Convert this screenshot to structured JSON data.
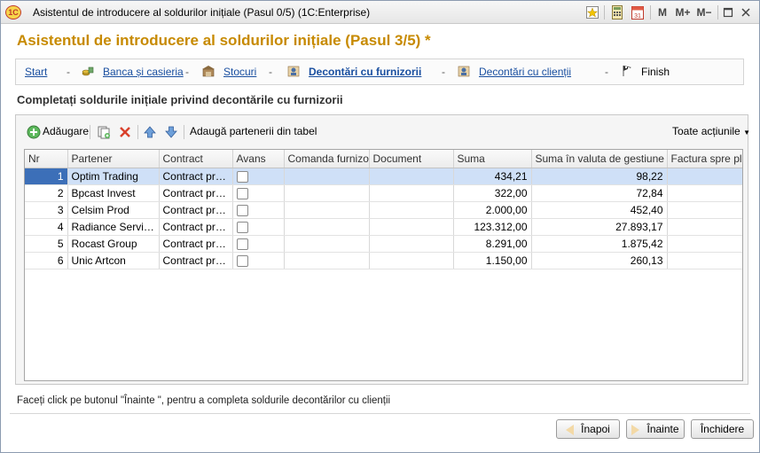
{
  "window": {
    "title": "Asistentul de introducere al soldurilor inițiale (Pasul 0/5)  (1C:Enterprise)",
    "app_icon": "1C",
    "buttons": [
      "M",
      "M+",
      "M−"
    ]
  },
  "header": {
    "title": "Asistentul de introducere al soldurilor inițiale (Pasul 3/5) *"
  },
  "steps": [
    {
      "label": "Start",
      "state": "link",
      "icon": ""
    },
    {
      "label": "Banca și casieria",
      "state": "link",
      "icon": "coins-icon"
    },
    {
      "label": "Stocuri",
      "state": "link",
      "icon": "warehouse-icon"
    },
    {
      "label": "Decontări cu furnizorii",
      "state": "active",
      "icon": "supplier-icon"
    },
    {
      "label": "Decontări cu clienții",
      "state": "link",
      "icon": "client-icon"
    },
    {
      "label": "Finish",
      "state": "plain",
      "icon": "finish-flag-icon"
    }
  ],
  "section": {
    "title": "Completați soldurile inițiale privind decontările cu furnizorii"
  },
  "toolbar": {
    "add_label": "Adăugare",
    "add_from_table_label": "Adaugă partenerii din tabel",
    "all_actions_label": "Toate acțiunile"
  },
  "table": {
    "columns": [
      "Nr",
      "Partener",
      "Contract",
      "Avans",
      "Comanda furnizor",
      "Document",
      "Suma",
      "Suma în valuta de gestiune",
      "Factura spre pl..."
    ],
    "rows": [
      {
        "nr": "1",
        "partener": "Optim Trading",
        "contract": "Contract prin...",
        "suma": "434,21",
        "suma_valuta": "98,22"
      },
      {
        "nr": "2",
        "partener": "Bpcast Invest",
        "contract": "Contract prin...",
        "suma": "322,00",
        "suma_valuta": "72,84"
      },
      {
        "nr": "3",
        "partener": "Celsim Prod",
        "contract": "Contract prin...",
        "suma": "2.000,00",
        "suma_valuta": "452,40"
      },
      {
        "nr": "4",
        "partener": "Radiance Service",
        "contract": "Contract prin...",
        "suma": "123.312,00",
        "suma_valuta": "27.893,17"
      },
      {
        "nr": "5",
        "partener": "Rocast Group",
        "contract": "Contract prin...",
        "suma": "8.291,00",
        "suma_valuta": "1.875,42"
      },
      {
        "nr": "6",
        "partener": "Unic Artcon",
        "contract": "Contract prin...",
        "suma": "1.150,00",
        "suma_valuta": "260,13"
      }
    ],
    "selected_row": 1
  },
  "footer": {
    "note": "Faceți click pe butonul \"Înainte \", pentru a completa soldurile decontărilor cu clienții",
    "back_label": "Înapoi",
    "next_label": "Înainte",
    "close_label": "Închidere"
  },
  "colors": {
    "heading": "#c78a00",
    "link": "#1a4fa0",
    "selection": "#cfe0f7"
  }
}
